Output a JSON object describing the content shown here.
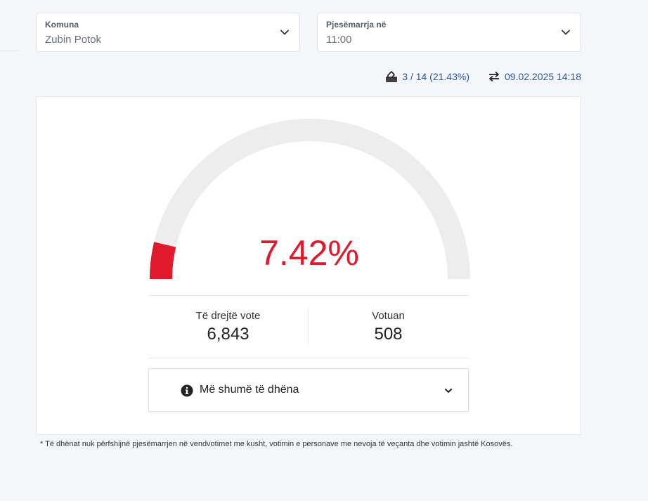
{
  "filters": {
    "komuna": {
      "label": "Komuna",
      "value": "Zubin Potok"
    },
    "pjesemarrja": {
      "label": "Pjesëmarrja në",
      "value": "11:00"
    }
  },
  "meta": {
    "polling_stations": "3 / 14 (21.43%)",
    "last_update": "09.02.2025 14:18"
  },
  "gauge": {
    "percent_label": "7.42%",
    "percent_value": 7.42,
    "fill_color": "#e0192d",
    "track_color": "#ededed"
  },
  "stats": {
    "eligible_label": "Të drejtë vote",
    "eligible_value": "6,843",
    "voted_label": "Votuan",
    "voted_value": "508"
  },
  "more": {
    "label": "Më shumë të dhëna"
  },
  "footnote": "* Të dhënat nuk përfshijnë pjesëmarrjen në vendvotimet me kusht, votimin e personave me nevoja të veçanta dhe votimin jashtë Kosovës.",
  "icons": {
    "ballot": "ballot-box-icon",
    "refresh": "sync-arrows-icon",
    "info": "info-circle-icon",
    "chevron": "chevron-down-icon"
  }
}
